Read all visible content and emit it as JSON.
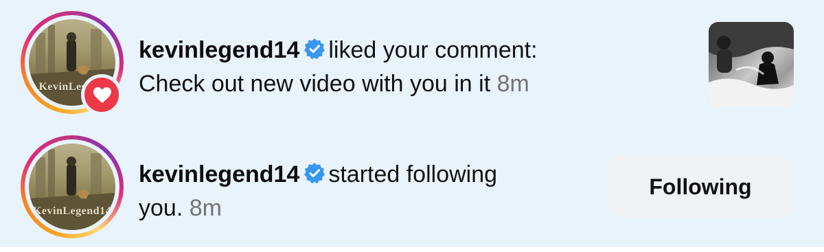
{
  "notifications": [
    {
      "username": "kevinlegend14",
      "verified": true,
      "action_line1": "liked your comment:",
      "action_line2": "Check out new video with you in it",
      "time": "8m",
      "avatar_poster_text": "KevinLegend",
      "badge_icon": "heart-icon",
      "thumbnail_icon": "post-thumbnail"
    },
    {
      "username": "kevinlegend14",
      "verified": true,
      "action_line1": "started following",
      "action_line2": "you.",
      "time": "8m",
      "avatar_poster_text": "KevinLegend14",
      "button_label": "Following"
    }
  ],
  "colors": {
    "background": "#e8f3fc",
    "verified_blue": "#3897f0",
    "heart_red": "#ed3847",
    "timestamp_gray": "#737373",
    "button_bg": "#eff1f5"
  }
}
